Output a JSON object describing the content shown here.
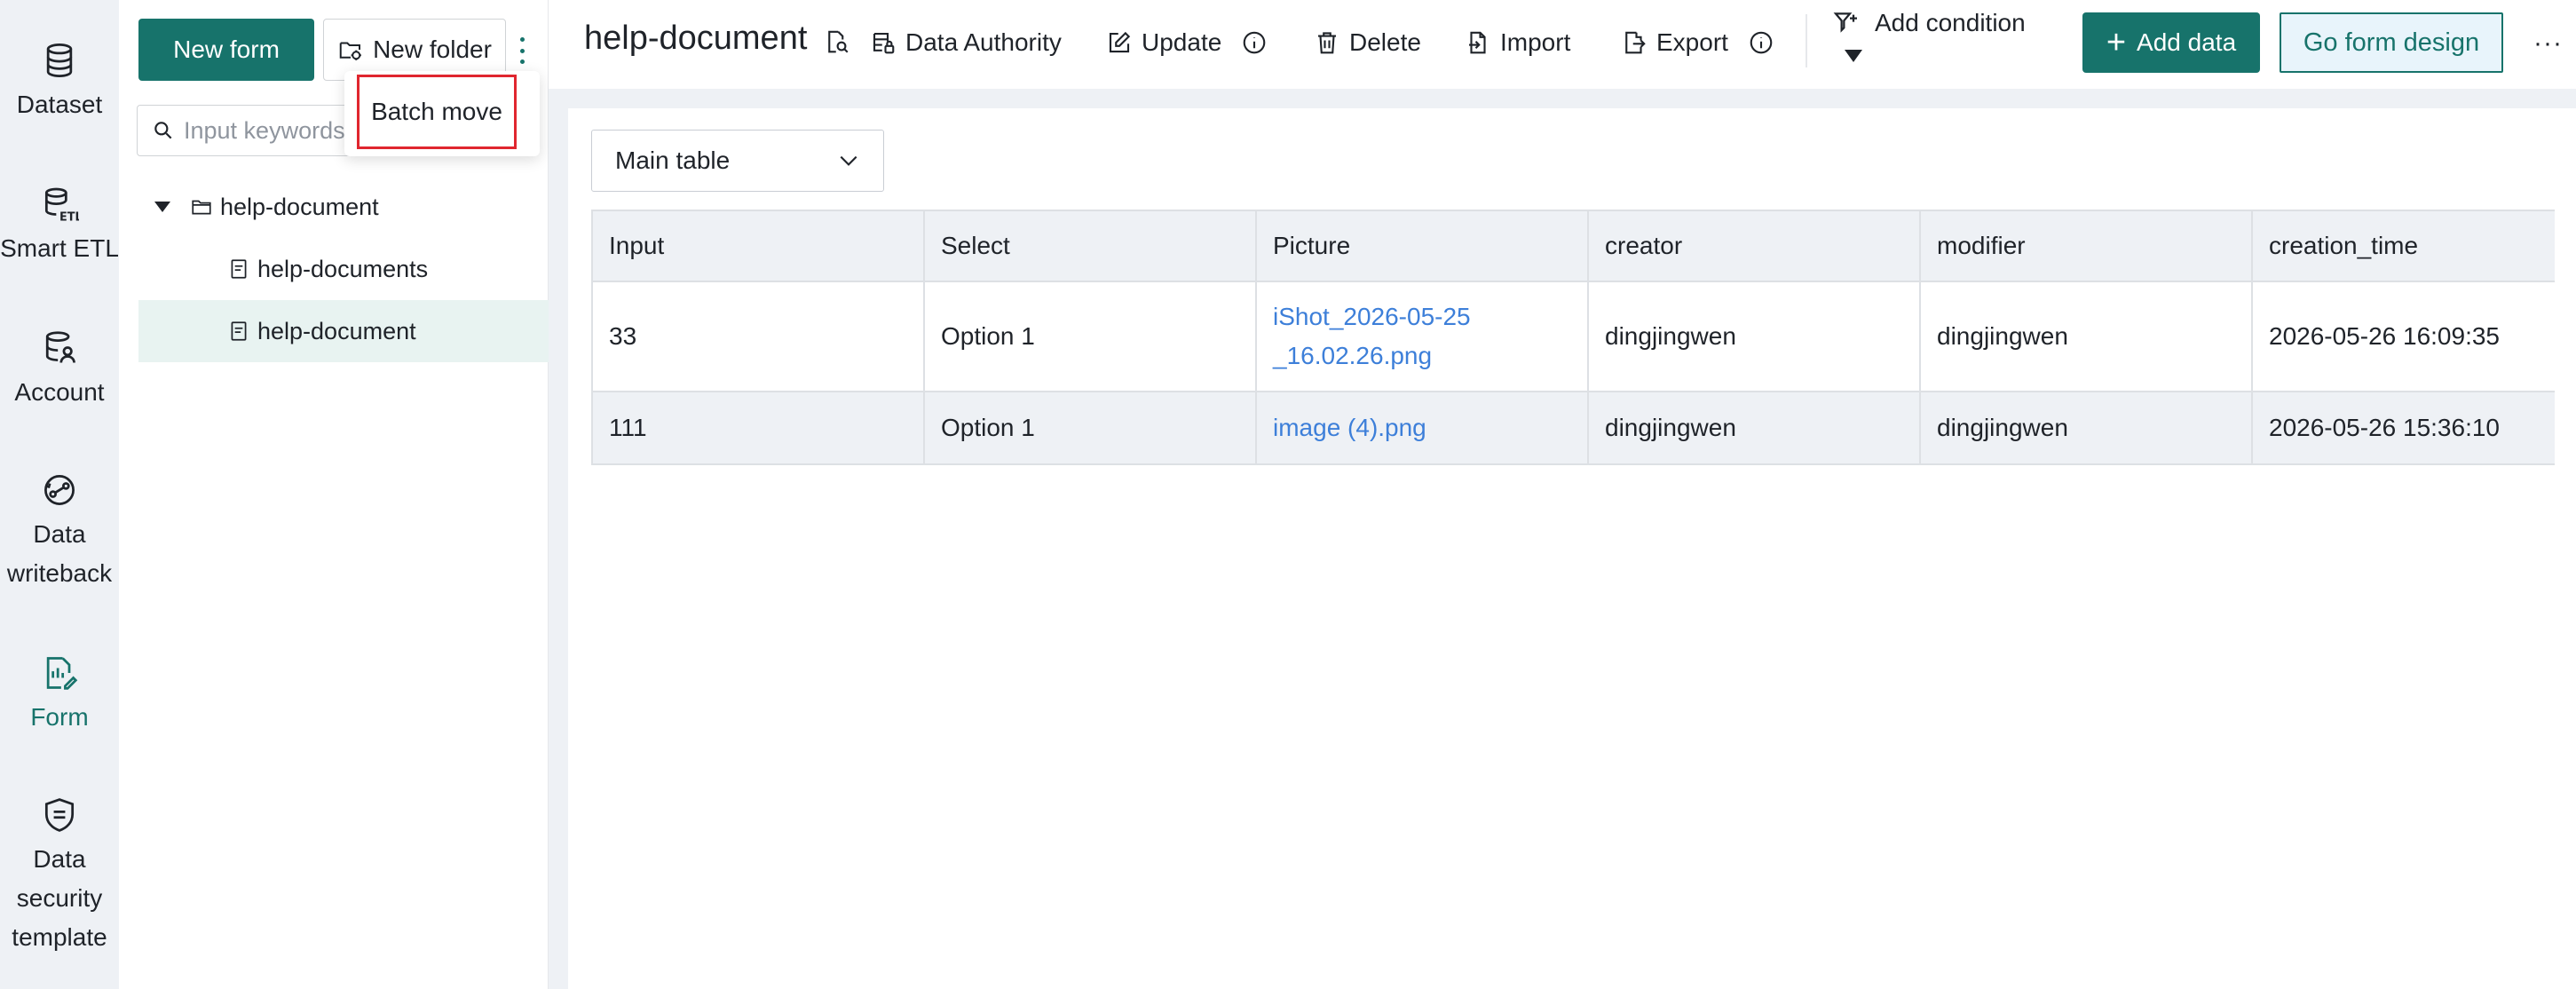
{
  "nav": {
    "items": [
      {
        "label": "Dataset",
        "icon": "database-icon"
      },
      {
        "label": "Smart ETL",
        "icon": "etl-icon"
      },
      {
        "label": "Account",
        "icon": "account-database-icon"
      },
      {
        "label": "Data writeback",
        "icon": "writeback-icon"
      },
      {
        "label": "Form",
        "icon": "form-icon",
        "active": true
      },
      {
        "label": "Data security template",
        "icon": "shield-template-icon"
      }
    ]
  },
  "tree": {
    "new_form_label": "New form",
    "new_folder_label": "New folder",
    "search_placeholder": "Input keywords",
    "folder": "help-document",
    "children": [
      "help-documents",
      "help-document"
    ],
    "selected_child": "help-document",
    "menu": {
      "batch_move_label": "Batch move"
    }
  },
  "toolbar": {
    "title": "help-document",
    "data_authority": "Data Authority",
    "update": "Update",
    "delete": "Delete",
    "import": "Import",
    "export": "Export",
    "add_condition": "Add condition",
    "add_data": "Add data",
    "go_form_design": "Go form design",
    "more": "···"
  },
  "table": {
    "selector": "Main table",
    "columns": [
      "Input",
      "Select",
      "Picture",
      "creator",
      "modifier",
      "creation_time"
    ],
    "rows": [
      [
        "33",
        "Option 1",
        "iShot_2026-05-25_16.02.26.png",
        "dingjingwen",
        "dingjingwen",
        "2026-05-26 16:09:35"
      ],
      [
        "111",
        "Option 1",
        "image (4).png",
        "dingjingwen",
        "dingjingwen",
        "2026-05-26 15:36:10"
      ]
    ]
  },
  "colors": {
    "brand": "#17736b",
    "link": "#3d7fd9",
    "highlight_border": "#e0262f",
    "panel_bg": "#eef1f5"
  }
}
